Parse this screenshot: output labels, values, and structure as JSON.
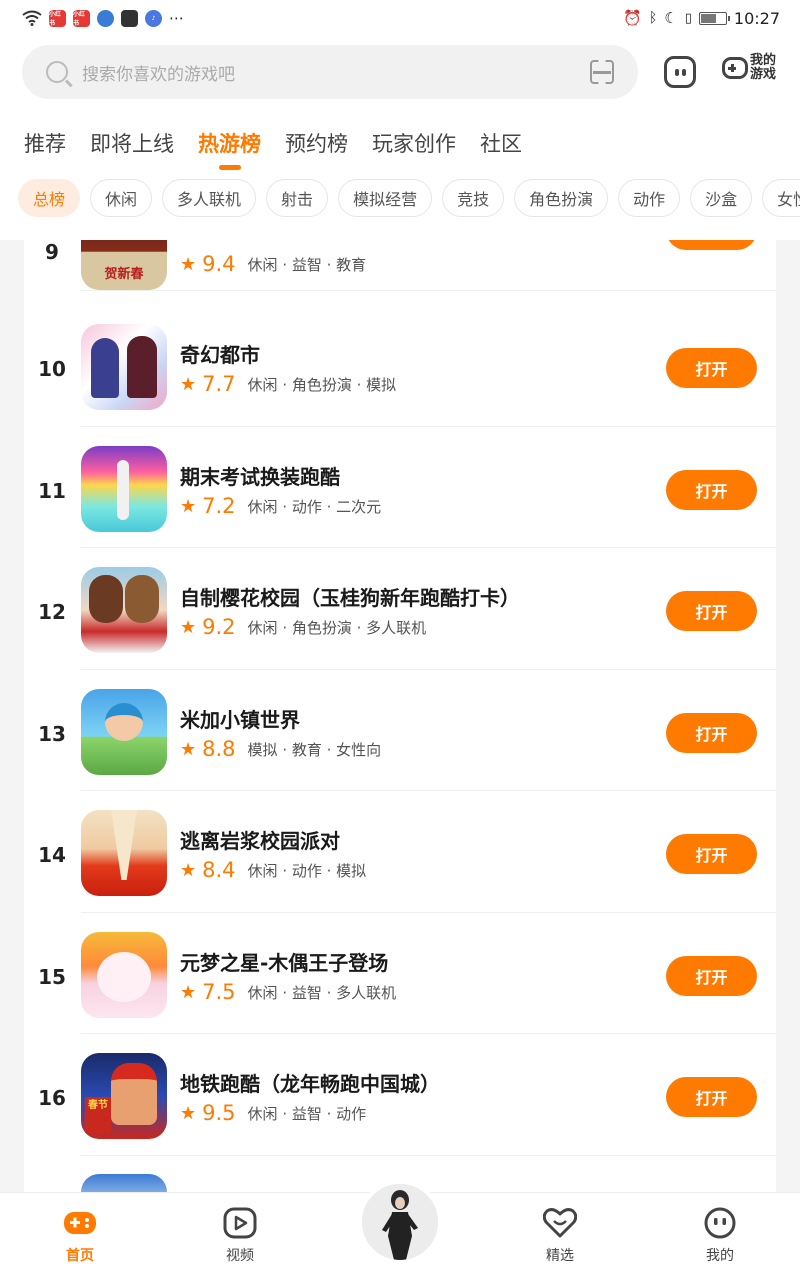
{
  "status_bar": {
    "badges": [
      "小红书",
      "小红书"
    ],
    "time": "10:27"
  },
  "search": {
    "placeholder": "搜索你喜欢的游戏吧"
  },
  "header": {
    "my_games_label": "我的游戏"
  },
  "tabs": [
    {
      "label": "推荐",
      "active": false
    },
    {
      "label": "即将上线",
      "active": false
    },
    {
      "label": "热游榜",
      "active": true
    },
    {
      "label": "预约榜",
      "active": false
    },
    {
      "label": "玩家创作",
      "active": false
    },
    {
      "label": "社区",
      "active": false
    }
  ],
  "chips": [
    {
      "label": "总榜",
      "active": true
    },
    {
      "label": "休闲"
    },
    {
      "label": "多人联机"
    },
    {
      "label": "射击"
    },
    {
      "label": "模拟经营"
    },
    {
      "label": "竞技"
    },
    {
      "label": "角色扮演"
    },
    {
      "label": "动作"
    },
    {
      "label": "沙盒"
    },
    {
      "label": "女性"
    }
  ],
  "games": [
    {
      "rank": "9",
      "name": "",
      "score": "9.4",
      "tags": "休闲 · 益智 · 教育",
      "button": "打开",
      "icon_text": "贺新春"
    },
    {
      "rank": "10",
      "name": "奇幻都市",
      "score": "7.7",
      "tags": "休闲 · 角色扮演 · 模拟",
      "button": "打开"
    },
    {
      "rank": "11",
      "name": "期末考试换装跑酷",
      "score": "7.2",
      "tags": "休闲 · 动作 · 二次元",
      "button": "打开"
    },
    {
      "rank": "12",
      "name": "自制樱花校园（玉桂狗新年跑酷打卡）",
      "score": "9.2",
      "tags": "休闲 · 角色扮演 · 多人联机",
      "button": "打开"
    },
    {
      "rank": "13",
      "name": "米加小镇世界",
      "score": "8.8",
      "tags": "模拟 · 教育 · 女性向",
      "button": "打开"
    },
    {
      "rank": "14",
      "name": "逃离岩浆校园派对",
      "score": "8.4",
      "tags": "休闲 · 动作 · 模拟",
      "button": "打开"
    },
    {
      "rank": "15",
      "name": "元梦之星-木偶王子登场",
      "score": "7.5",
      "tags": "休闲 · 益智 · 多人联机",
      "button": "打开"
    },
    {
      "rank": "16",
      "name": "地铁跑酷（龙年畅跑中国城）",
      "score": "9.5",
      "tags": "休闲 · 益智 · 动作",
      "button": "打开",
      "icon_text": "春节"
    }
  ],
  "bottom_nav": [
    {
      "label": "首页",
      "icon": "gamepad-icon",
      "active": true
    },
    {
      "label": "视频",
      "icon": "video-icon"
    },
    {
      "label": "精选",
      "icon": "heart-icon"
    },
    {
      "label": "我的",
      "icon": "face-icon"
    }
  ],
  "colors": {
    "accent": "#ff7a00",
    "chip_active_bg": "#ffece0"
  }
}
